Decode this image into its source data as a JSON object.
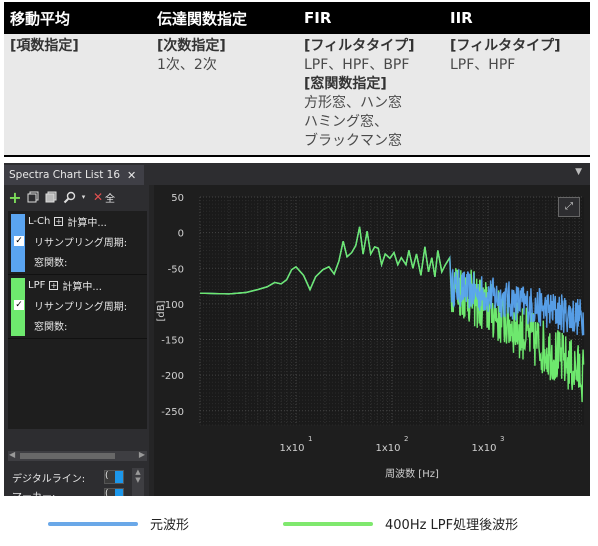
{
  "table": {
    "headers": [
      "移動平均",
      "伝達関数指定",
      "FIR",
      "IIR"
    ],
    "col0": {
      "title": "[項数指定]"
    },
    "col1": {
      "title": "[次数指定]",
      "line1": "1次、2次"
    },
    "col2": {
      "title1": "[フィルタタイプ]",
      "line1": "LPF、HPF、BPF",
      "title2": "[窓関数指定]",
      "line2": "方形窓、ハン窓",
      "line3": "ハミング窓、",
      "line4": "ブラックマン窓"
    },
    "col3": {
      "title": "[フィルタタイプ]",
      "line1": "LPF、HPF"
    }
  },
  "app": {
    "tab_title": "Spectra Chart List 16",
    "toolbar": {
      "delete_all_label": "全"
    },
    "items": [
      {
        "name": "L-Ch",
        "status": "計算中...",
        "prop1": "リサンプリング周期:",
        "prop2": "窓関数:",
        "color": "#5aa4f0"
      },
      {
        "name": "LPF",
        "status": "計算中...",
        "prop1": "リサンプリング周期:",
        "prop2": "窓関数:",
        "color": "#6ee86e"
      }
    ],
    "props": {
      "digital_line": "デジタルライン:",
      "marker": "マーカー:",
      "digital_line_value": "(",
      "marker_value": "("
    }
  },
  "chart_data": {
    "type": "line",
    "ylabel": "[dB]",
    "xlabel": "周波数 [Hz]",
    "x_scale": "log",
    "y_ticks": [
      50,
      0,
      -50,
      -100,
      -150,
      -200,
      -250
    ],
    "ylim": [
      -270,
      50
    ],
    "x_tick_labels": [
      {
        "base": "1x10",
        "exp": "1"
      },
      {
        "base": "1x10",
        "exp": "2"
      },
      {
        "base": "1x10",
        "exp": "3"
      }
    ],
    "x_ticks": [
      10,
      100,
      1000
    ],
    "xlim": [
      1,
      10000
    ],
    "grid": true,
    "series": [
      {
        "name": "元波形",
        "color": "#5aa4f0"
      },
      {
        "name": "400Hz LPF処理後波形",
        "color": "#6ee86e"
      }
    ]
  },
  "legend": [
    {
      "label": "元波形",
      "color": "#6aa8e8"
    },
    {
      "label": "400Hz LPF処理後波形",
      "color": "#7fe86e"
    }
  ]
}
